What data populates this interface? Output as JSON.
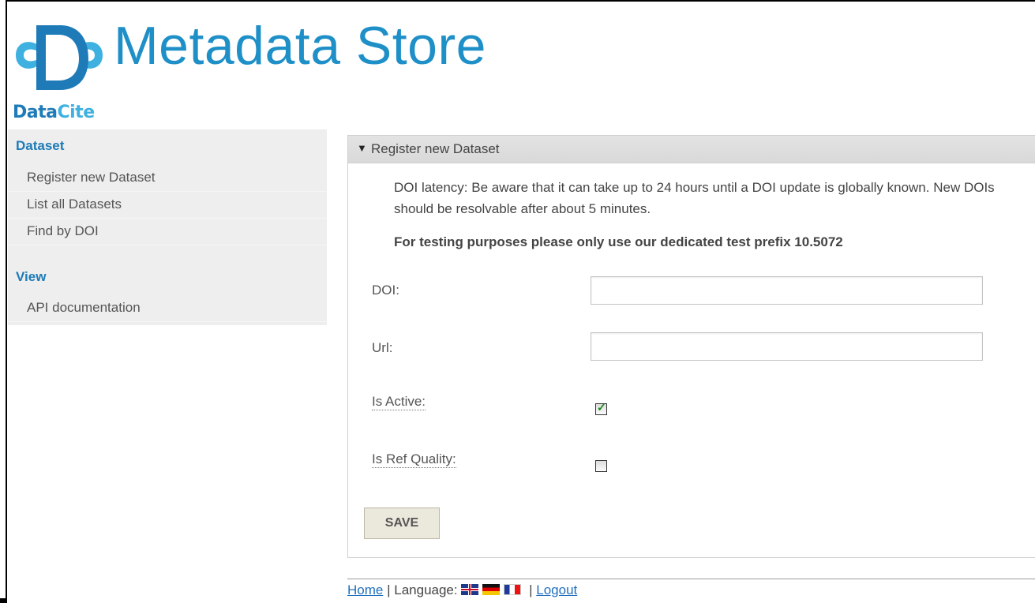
{
  "header": {
    "logo_data": "Data",
    "logo_cite": "Cite",
    "app_title": "Metadata Store"
  },
  "sidebar": {
    "sections": [
      {
        "heading": "Dataset",
        "items": [
          "Register new Dataset",
          "List all Datasets",
          "Find by DOI"
        ]
      },
      {
        "heading": "View",
        "items": [
          "API documentation"
        ]
      }
    ]
  },
  "panel": {
    "title": "Register new Dataset",
    "notice": "DOI latency: Be aware that it can take up to 24 hours until a DOI update is globally known. New DOIs should be resolvable after about 5 minutes.",
    "notice_bold": "For testing purposes please only use our dedicated test prefix 10.5072",
    "fields": {
      "doi_label": "DOI:",
      "doi_value": "",
      "url_label": "Url:",
      "url_value": "",
      "is_active_label": "Is Active:",
      "is_active_checked": true,
      "is_ref_quality_label": "Is Ref Quality:",
      "is_ref_quality_checked": false
    },
    "save_label": "SAVE"
  },
  "footer": {
    "home_label": "Home",
    "separator": "|",
    "language_label": "Language:",
    "logout_label": "Logout",
    "flags": [
      "english-flag",
      "german-flag",
      "french-flag"
    ]
  },
  "colors": {
    "brand_blue": "#1e8fc7",
    "link_blue": "#1f6fbf",
    "sidebar_bg": "#eeeeee"
  }
}
